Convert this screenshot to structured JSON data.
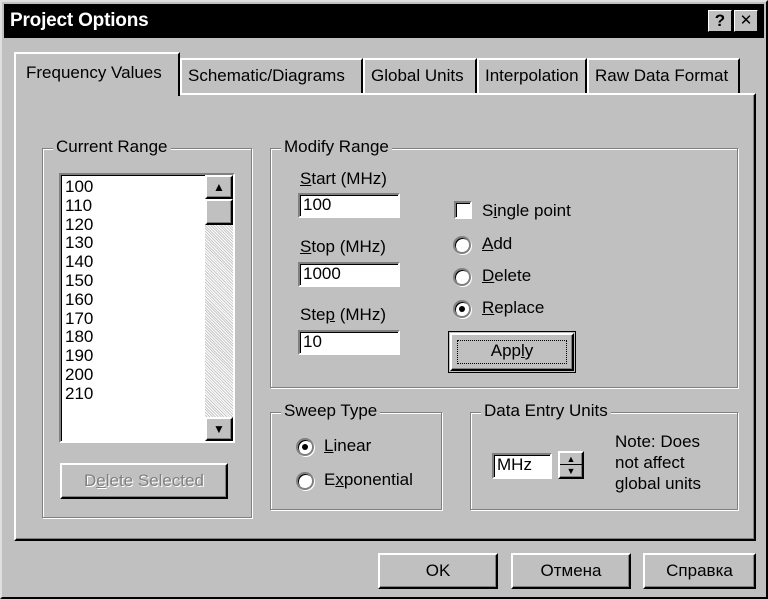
{
  "window": {
    "title": "Project Options",
    "help_glyph": "?",
    "close_glyph": "✕"
  },
  "tabs": [
    {
      "label": "Frequency Values"
    },
    {
      "label": "Schematic/Diagrams"
    },
    {
      "label": "Global Units"
    },
    {
      "label": "Interpolation"
    },
    {
      "label": "Raw Data Format"
    }
  ],
  "current_range": {
    "label": "Current Range",
    "items": [
      "100",
      "110",
      "120",
      "130",
      "140",
      "150",
      "160",
      "170",
      "180",
      "190",
      "200",
      "210"
    ],
    "scroll_up_glyph": "▲",
    "scroll_down_glyph": "▼",
    "delete_button": {
      "pre": "D",
      "accel": "e",
      "post": "lete Selected"
    }
  },
  "modify_range": {
    "label": "Modify Range",
    "start": {
      "pre": "",
      "accel": "S",
      "post": "tart (MHz)",
      "value": "100"
    },
    "stop": {
      "pre": "",
      "accel": "S",
      "post": "top (MHz)",
      "value": "1000"
    },
    "step": {
      "pre": "Ste",
      "accel": "p",
      "post": " (MHz)",
      "value": "10"
    },
    "single_point": {
      "pre": "S",
      "accel": "i",
      "post": "ngle point",
      "checked": false
    },
    "add": {
      "pre": "",
      "accel": "A",
      "post": "dd"
    },
    "delete": {
      "pre": "",
      "accel": "D",
      "post": "elete"
    },
    "replace": {
      "pre": "",
      "accel": "R",
      "post": "eplace"
    },
    "selected_mode": "replace",
    "apply": {
      "pre": "App",
      "accel": "l",
      "post": "y"
    }
  },
  "sweep_type": {
    "label": "Sweep Type",
    "linear": {
      "pre": "",
      "accel": "L",
      "post": "inear"
    },
    "exponential": {
      "pre": "E",
      "accel": "x",
      "post": "ponential"
    },
    "selected": "linear"
  },
  "data_entry_units": {
    "label": "Data Entry Units",
    "value": "MHz",
    "note_line1": "Note: Does",
    "note_line2": "not affect",
    "note_line3": "global units"
  },
  "footer": {
    "ok": "OK",
    "cancel": "Отмена",
    "help": "Справка"
  }
}
